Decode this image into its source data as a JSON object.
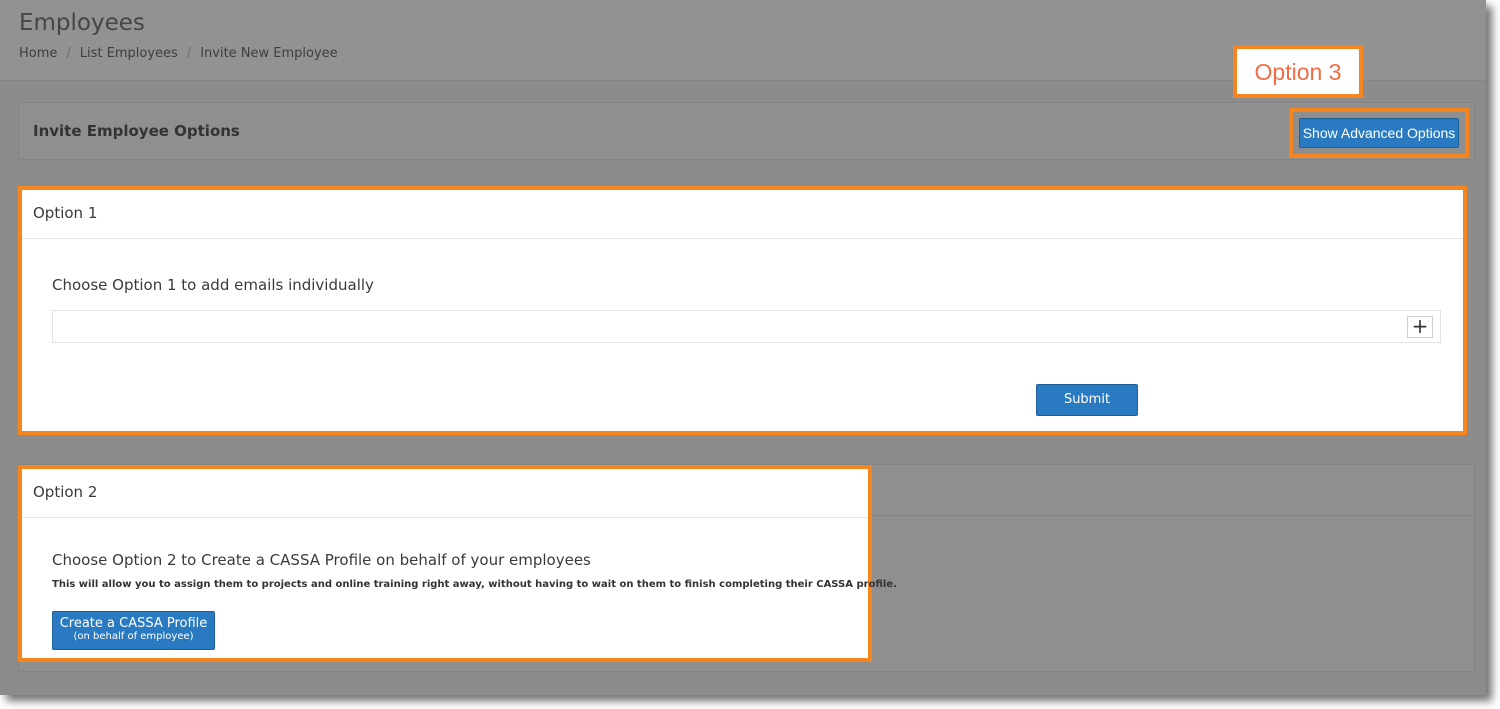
{
  "header": {
    "title": "Employees",
    "breadcrumb": [
      "Home",
      "List Employees",
      "Invite New Employee"
    ]
  },
  "options_panel": {
    "title": "Invite Employee Options",
    "advanced_button": "Show Advanced Options"
  },
  "callout": {
    "label": "Option 3"
  },
  "option1": {
    "title": "Option 1",
    "heading": "Choose Option 1 to add emails individually",
    "email_value": "",
    "add_icon": "plus-icon",
    "submit": "Submit"
  },
  "option2": {
    "title": "Option 2",
    "heading": "Choose Option 2 to Create a CASSA Profile on behalf of your employees",
    "description": "This will allow you to assign them to projects and online training right away, without having to wait on them to finish completing their CASSA profile.",
    "button_main": "Create a CASSA Profile",
    "button_sub": "(on behalf of employee)"
  },
  "colors": {
    "highlight": "#f5861f",
    "primary_button": "#2a7ac2",
    "callout_text": "#f26b45"
  }
}
